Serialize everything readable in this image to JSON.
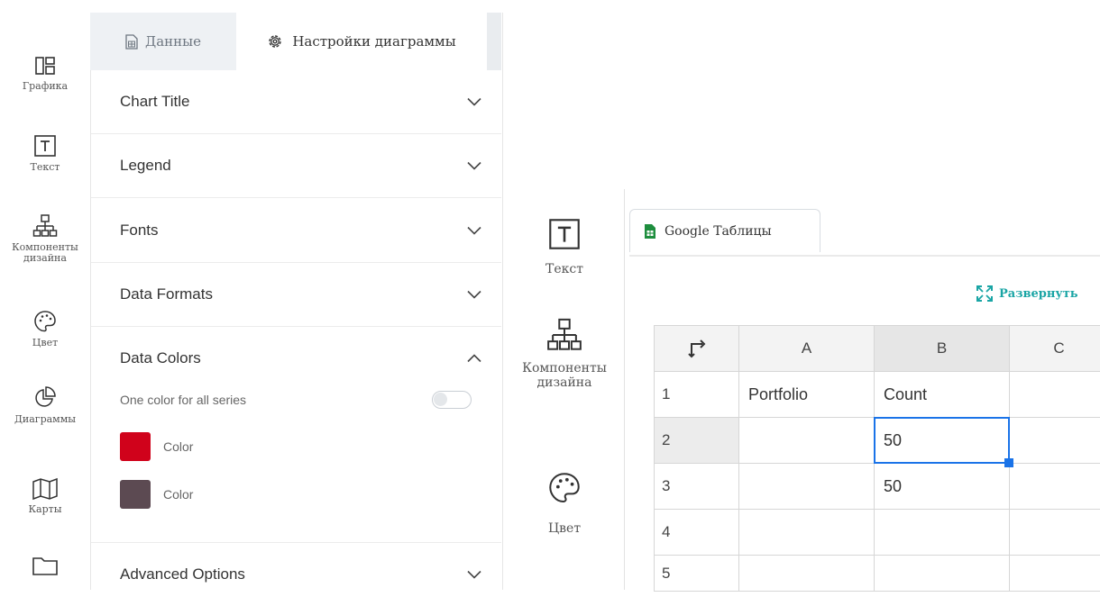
{
  "left_rail": {
    "items": [
      {
        "label": "Графика",
        "icon": "graphics-grid-icon"
      },
      {
        "label": "Текст",
        "icon": "text-box-icon"
      },
      {
        "label": "Компоненты дизайна",
        "icon": "hierarchy-icon"
      },
      {
        "label": "Цвет",
        "icon": "palette-icon"
      },
      {
        "label": "Диаграммы",
        "icon": "pie-chart-icon"
      },
      {
        "label": "Карты",
        "icon": "map-icon"
      },
      {
        "label": "",
        "icon": "folder-icon"
      }
    ]
  },
  "tabs": {
    "data_label": "Данные",
    "settings_label": "Настройки диаграммы"
  },
  "sections": {
    "chart_title": "Chart Title",
    "legend": "Legend",
    "fonts": "Fonts",
    "data_formats": "Data Formats",
    "data_colors": "Data Colors",
    "advanced": "Advanced Options"
  },
  "data_colors": {
    "one_color_label": "One color for all series",
    "one_color_enabled": false,
    "colors": [
      {
        "label": "Color",
        "hex": "#d0021b"
      },
      {
        "label": "Color",
        "hex": "#5c4a52"
      }
    ]
  },
  "right_rail": {
    "items": [
      {
        "label": "Текст",
        "icon": "text-box-icon"
      },
      {
        "label": "Компоненты дизайна",
        "icon": "hierarchy-icon"
      },
      {
        "label": "Цвет",
        "icon": "palette-icon"
      }
    ]
  },
  "sheet": {
    "google_button": "Google Таблицы",
    "expand_label": "Развернуть",
    "columns": [
      "A",
      "B",
      "C"
    ],
    "rows": [
      {
        "n": "1",
        "a": "Portfolio",
        "b": "Count"
      },
      {
        "n": "2",
        "a": "",
        "b": "50"
      },
      {
        "n": "3",
        "a": "",
        "b": "50"
      },
      {
        "n": "4",
        "a": "",
        "b": ""
      },
      {
        "n": "5",
        "a": "",
        "b": ""
      }
    ],
    "selected_cell": "B2",
    "accent": "#1a73e8"
  }
}
